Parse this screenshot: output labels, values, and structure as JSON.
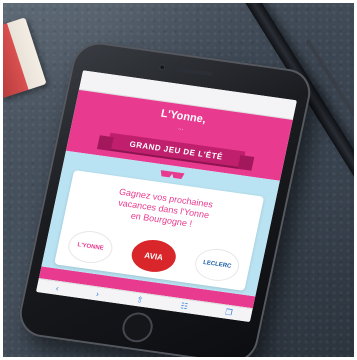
{
  "scene": {
    "objects": [
      "notebook",
      "smartphone",
      "pen"
    ]
  },
  "phone_screen": {
    "status_bar": "",
    "url": "",
    "hero_title": "L'Yonne,",
    "hero_subtitle": "...",
    "ribbon_text": "GRAND JEU DE L'ÉTÉ",
    "card_line1": "Gagnez vos prochaines",
    "card_line2": "vacances dans l'Yonne",
    "card_line3": "en Bourgogne !",
    "sponsors": [
      {
        "label": "L'YONNE"
      },
      {
        "label": "AVIA"
      },
      {
        "label": "LECLERC"
      }
    ],
    "toolbar_icons": [
      "back-icon",
      "forward-icon",
      "share-icon",
      "bookmarks-icon",
      "tabs-icon"
    ]
  },
  "colors": {
    "brand_pink": "#e83a8e",
    "ribbon": "#c01f6e",
    "sky": "#b9e3f2"
  }
}
